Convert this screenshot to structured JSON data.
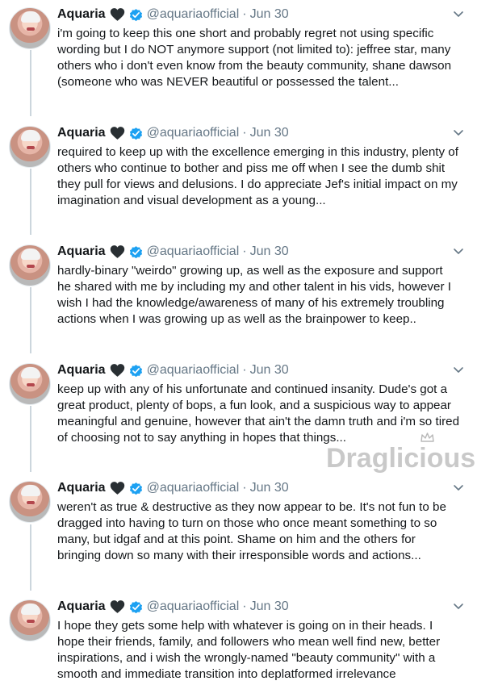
{
  "tweets": [
    {
      "name": "Aquaria",
      "handle": "@aquariaofficial",
      "date": "Jun 30",
      "lines": [
        "i'm going to keep this one short and probably regret not using specific",
        "wording but I do NOT anymore support (not limited to): jeffree star, many",
        "others who i don't even know from the beauty community, shane dawson",
        "(someone who was NEVER beautiful or possessed the talent..."
      ]
    },
    {
      "name": "Aquaria",
      "handle": "@aquariaofficial",
      "date": "Jun 30",
      "lines": [
        "required to keep up with the excellence emerging in this industry, plenty of",
        "others who continue to bother and piss me off when I see the dumb shit",
        "they pull for views and delusions. I do appreciate Jef's initial impact on my",
        "imagination and visual development as a young..."
      ]
    },
    {
      "name": "Aquaria",
      "handle": "@aquariaofficial",
      "date": "Jun 30",
      "lines": [
        "hardly-binary \"weirdo\" growing up, as well as the exposure and support",
        "he shared with me by including my and other talent in his vids, however I",
        "wish I had the knowledge/awareness of many of his extremely troubling",
        "actions when I was growing up as well as the brainpower to keep.."
      ]
    },
    {
      "name": "Aquaria",
      "handle": "@aquariaofficial",
      "date": "Jun 30",
      "lines": [
        "keep up with any of his unfortunate and continued insanity. Dude's got a",
        "great product, plenty of bops, a fun look, and a suspicious way to appear",
        "meaningful and genuine, however that ain't the damn truth and i'm so tired",
        "of choosing not to say anything in hopes that things..."
      ]
    },
    {
      "name": "Aquaria",
      "handle": "@aquariaofficial",
      "date": "Jun 30",
      "lines": [
        "weren't as true & destructive as they now appear to be. It's not fun to be",
        "dragged into having to turn on those who once meant something to so",
        "many, but idgaf and at this point. Shame on him and the others for",
        "bringing down so many with their irresponsible words and actions..."
      ]
    },
    {
      "name": "Aquaria",
      "handle": "@aquariaofficial",
      "date": "Jun 30",
      "lines": [
        "I hope they gets some help with whatever is going on in their heads. I",
        "hope their friends, family, and followers who mean well find new, better",
        "inspirations, and i wish the wrongly-named \"beauty community\" with a",
        "smooth and immediate transition into deplatformed irrelevance"
      ]
    }
  ],
  "separator": "·",
  "watermark": "Draglicious",
  "colors": {
    "name": "#14171a",
    "meta": "#657786",
    "verified": "#1da1f2",
    "thread_line": "#ccd6dd"
  },
  "icons": {
    "heart": "black-heart-icon",
    "verified": "verified-badge-icon",
    "menu": "chevron-down-icon"
  }
}
